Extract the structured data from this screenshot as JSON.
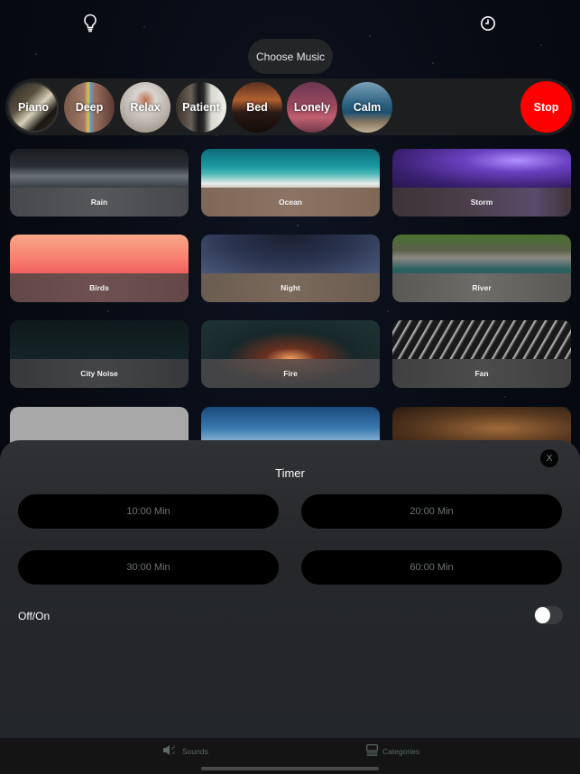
{
  "header": {
    "left_icon": "lightbulb-icon",
    "right_icon": "clock-icon",
    "choose_music_label": "Choose Music"
  },
  "music_bar": {
    "items": [
      {
        "label": "Piano",
        "active": true
      },
      {
        "label": "Deep"
      },
      {
        "label": "Relax"
      },
      {
        "label": "Patient"
      },
      {
        "label": "Bed"
      },
      {
        "label": "Lonely"
      },
      {
        "label": "Calm"
      }
    ],
    "stop_label": "Stop",
    "stop_color": "#ff0000"
  },
  "sounds": [
    {
      "label": "Rain"
    },
    {
      "label": "Ocean"
    },
    {
      "label": "Storm"
    },
    {
      "label": "Birds"
    },
    {
      "label": "Night"
    },
    {
      "label": "River"
    },
    {
      "label": "City Noise"
    },
    {
      "label": "Fire"
    },
    {
      "label": "Fan"
    }
  ],
  "timer_sheet": {
    "title": "Timer",
    "close_label": "X",
    "options": [
      "10:00 Min",
      "20:00 Min",
      "30:00 Min",
      "60:00 Min"
    ],
    "toggle_label": "Off/On",
    "toggle_on": false
  },
  "tabbar": {
    "tabs": [
      {
        "label": "Sounds",
        "icon": "speaker-icon"
      },
      {
        "label": "Categories",
        "icon": "categories-icon"
      }
    ]
  }
}
